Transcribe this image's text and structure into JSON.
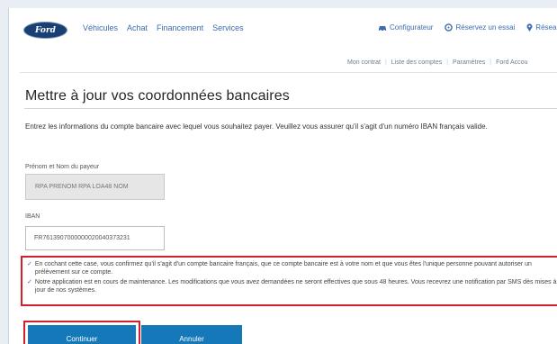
{
  "brand": {
    "logo_text": "Ford"
  },
  "nav": {
    "main": [
      "Véhicules",
      "Achat",
      "Financement",
      "Services"
    ],
    "right": [
      {
        "label": "Configurateur",
        "icon": "car-icon"
      },
      {
        "label": "Réservez un essai",
        "icon": "steering-wheel-icon"
      },
      {
        "label": "Résea",
        "icon": "location-pin-icon"
      }
    ]
  },
  "subnav": [
    "Mon contrat",
    "Liste des comptes",
    "Paramètres",
    "Ford Accou"
  ],
  "page": {
    "title": "Mettre à jour vos coordonnées bancaires",
    "intro": "Entrez les informations du compte bancaire avec lequel vous souhaitez payer. Veuillez vous assurer qu'il s'agit d'un numéro IBAN français valide."
  },
  "form": {
    "payer_label": "Prénom et Nom du payeur",
    "payer_value": "RPA PRENOM RPA LOA48 NOM",
    "iban_label": "IBAN",
    "iban_value": "FR7613907000000020040373231"
  },
  "notices": [
    "En cochant cette case, vous confirmez qu'il s'agit d'un compte bancaire français, que ce compte bancaire est à votre nom et que vous êtes l'unique personne pouvant autoriser un prélèvement sur ce compte.",
    "Notre application est en cours de maintenance. Les modifications que vous avez demandées ne seront effectives que sous 48 heures. Vous recevrez une notification par SMS dès mises à jour de nos systèmes."
  ],
  "buttons": {
    "continue": "Continuer",
    "cancel": "Annuler"
  },
  "colors": {
    "brand_blue": "#1a3f73",
    "link_blue": "#3b6bb0",
    "button_blue": "#1579b9",
    "highlight_red": "#d21f2b"
  }
}
